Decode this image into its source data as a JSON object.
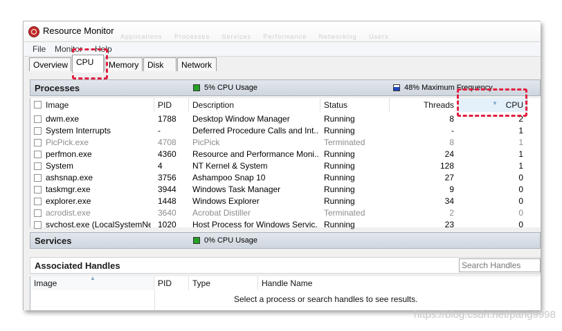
{
  "window": {
    "title": "Resource Monitor",
    "ghost_tabs": "Applications Processes Services Performance Networking Users"
  },
  "menu": [
    "File",
    "Monitor",
    "Help"
  ],
  "tabs": [
    {
      "label": "Overview",
      "active": false
    },
    {
      "label": "CPU",
      "active": true
    },
    {
      "label": "Memory",
      "active": false
    },
    {
      "label": "Disk",
      "active": false
    },
    {
      "label": "Network",
      "active": false
    }
  ],
  "processes": {
    "title": "Processes",
    "cpu_usage": "5% CPU Usage",
    "max_frequency": "48% Maximum Frequency",
    "columns": [
      "Image",
      "PID",
      "Description",
      "Status",
      "Threads",
      "CPU"
    ],
    "rows": [
      {
        "image": "dwm.exe",
        "pid": "1788",
        "desc": "Desktop Window Manager",
        "status": "Running",
        "threads": "8",
        "cpu": "2",
        "terminated": false
      },
      {
        "image": "System Interrupts",
        "pid": "-",
        "desc": "Deferred Procedure Calls and Int...",
        "status": "Running",
        "threads": "-",
        "cpu": "1",
        "terminated": false
      },
      {
        "image": "PicPick.exe",
        "pid": "4708",
        "desc": "PicPick",
        "status": "Terminated",
        "threads": "8",
        "cpu": "1",
        "terminated": true
      },
      {
        "image": "perfmon.exe",
        "pid": "4360",
        "desc": "Resource and Performance Moni...",
        "status": "Running",
        "threads": "24",
        "cpu": "1",
        "terminated": false
      },
      {
        "image": "System",
        "pid": "4",
        "desc": "NT Kernel & System",
        "status": "Running",
        "threads": "128",
        "cpu": "1",
        "terminated": false
      },
      {
        "image": "ashsnap.exe",
        "pid": "3756",
        "desc": "Ashampoo Snap 10",
        "status": "Running",
        "threads": "27",
        "cpu": "0",
        "terminated": false
      },
      {
        "image": "taskmgr.exe",
        "pid": "3944",
        "desc": "Windows Task Manager",
        "status": "Running",
        "threads": "9",
        "cpu": "0",
        "terminated": false
      },
      {
        "image": "explorer.exe",
        "pid": "1448",
        "desc": "Windows Explorer",
        "status": "Running",
        "threads": "34",
        "cpu": "0",
        "terminated": false
      },
      {
        "image": "acrodist.exe",
        "pid": "3640",
        "desc": "Acrobat  Distiller",
        "status": "Terminated",
        "threads": "2",
        "cpu": "0",
        "terminated": true
      },
      {
        "image": "svchost.exe (LocalSystemNet...",
        "pid": "1020",
        "desc": "Host Process for Windows Servic...",
        "status": "Running",
        "threads": "23",
        "cpu": "0",
        "terminated": false
      }
    ]
  },
  "services": {
    "title": "Services",
    "cpu_usage": "0% CPU Usage"
  },
  "handles": {
    "title": "Associated Handles",
    "search_placeholder": "Search Handles",
    "columns": [
      "Image",
      "PID",
      "Type",
      "Handle Name"
    ],
    "message": "Select a process or search handles to see results."
  },
  "watermark": "https://blog.csdn.net/pang9998",
  "colors": {
    "highlight": "#e02040",
    "cpu_meter": "#24a124",
    "freq_meter": "#1f48c2"
  }
}
